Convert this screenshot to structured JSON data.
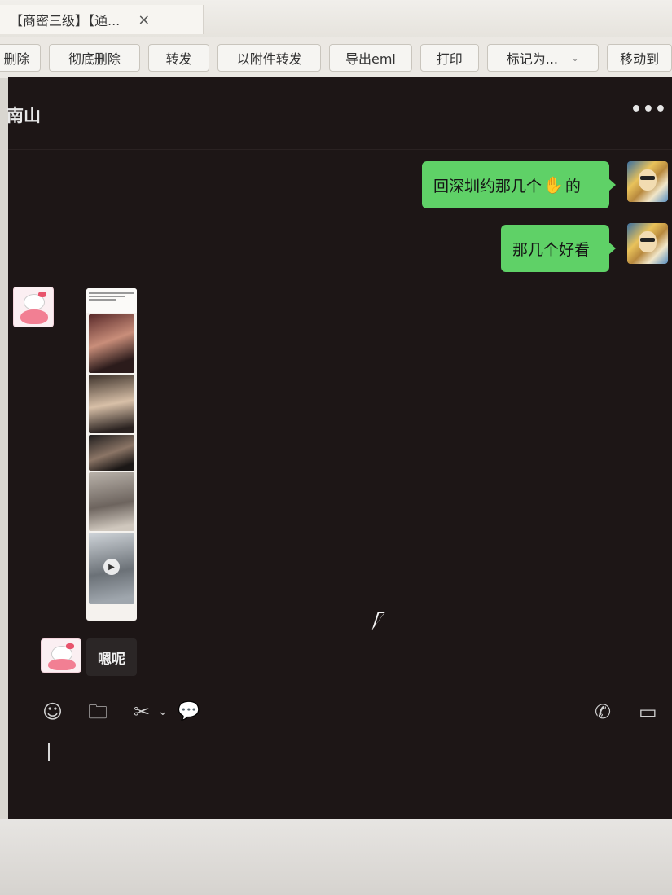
{
  "tab": {
    "title": "【商密三级】【通...",
    "close": "×"
  },
  "toolbar": {
    "delete": "删除",
    "perm_delete": "彻底删除",
    "forward": "转发",
    "forward_attach": "以附件转发",
    "export_eml": "导出eml",
    "print": "打印",
    "mark_as": "标记为...",
    "mark_caret": "⌄",
    "move_to": "移动到"
  },
  "chat": {
    "contact": "南山",
    "more": "•••",
    "messages": [
      {
        "from": "me",
        "text_before": "回深圳约那几个",
        "emoji": "✋",
        "text_after": "的"
      },
      {
        "from": "me",
        "text": "那几个好看"
      },
      {
        "from": "other",
        "type": "image",
        "play": "▶"
      },
      {
        "from": "other",
        "text": "嗯呢"
      }
    ]
  },
  "input_toolbar": {
    "emoji": "☺",
    "folder": "🗀",
    "scissors": "✂",
    "scissors_caret": "⌄",
    "chat_bubble": "💬",
    "phone": "✆",
    "video": "▭"
  }
}
